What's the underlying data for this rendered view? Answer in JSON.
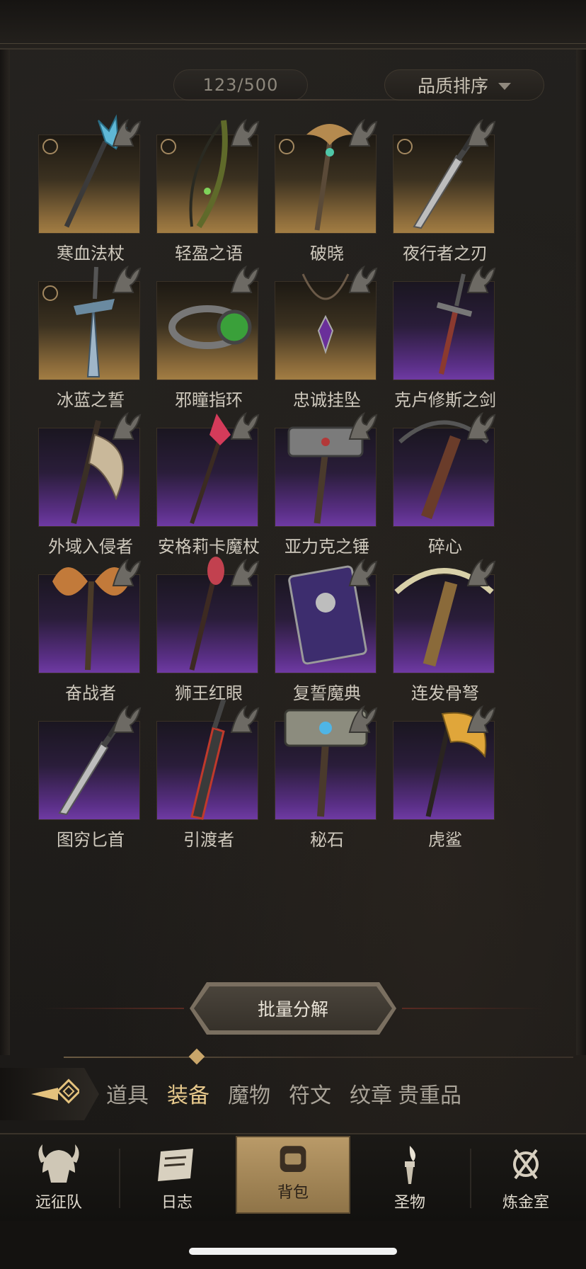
{
  "header": {
    "capacity": "123/500",
    "sort_label": "品质排序"
  },
  "items": [
    {
      "name": "寒血法杖",
      "rarity": "gold",
      "marked": true,
      "icon": "ice-staff"
    },
    {
      "name": "轻盈之语",
      "rarity": "gold",
      "marked": true,
      "icon": "bow"
    },
    {
      "name": "破晓",
      "rarity": "gold",
      "marked": true,
      "icon": "scepter"
    },
    {
      "name": "夜行者之刃",
      "rarity": "gold",
      "marked": true,
      "icon": "dagger"
    },
    {
      "name": "冰蓝之誓",
      "rarity": "gold",
      "marked": true,
      "icon": "ice-sword"
    },
    {
      "name": "邪瞳指环",
      "rarity": "gold",
      "marked": false,
      "icon": "ring"
    },
    {
      "name": "忠诚挂坠",
      "rarity": "gold",
      "marked": false,
      "icon": "pendant"
    },
    {
      "name": "克卢修斯之剑",
      "rarity": "purple",
      "marked": false,
      "icon": "sword"
    },
    {
      "name": "外域入侵者",
      "rarity": "purple",
      "marked": false,
      "icon": "axe"
    },
    {
      "name": "安格莉卡魔杖",
      "rarity": "purple",
      "marked": false,
      "icon": "wand"
    },
    {
      "name": "亚力克之锤",
      "rarity": "purple",
      "marked": false,
      "icon": "hammer"
    },
    {
      "name": "碎心",
      "rarity": "purple",
      "marked": false,
      "icon": "crossbow"
    },
    {
      "name": "奋战者",
      "rarity": "purple",
      "marked": false,
      "icon": "battle-axe"
    },
    {
      "name": "狮王红眼",
      "rarity": "purple",
      "marked": false,
      "icon": "ruby-wand"
    },
    {
      "name": "复誓魔典",
      "rarity": "purple",
      "marked": false,
      "icon": "tome"
    },
    {
      "name": "连发骨弩",
      "rarity": "purple",
      "marked": false,
      "icon": "bone-crossbow"
    },
    {
      "name": "图穷匕首",
      "rarity": "purple",
      "marked": false,
      "icon": "dagger"
    },
    {
      "name": "引渡者",
      "rarity": "purple",
      "marked": false,
      "icon": "greatsword"
    },
    {
      "name": "秘石",
      "rarity": "purple",
      "marked": false,
      "icon": "maul"
    },
    {
      "name": "虎鲨",
      "rarity": "purple",
      "marked": false,
      "icon": "golden-axe"
    }
  ],
  "batch_button": "批量分解",
  "categories": [
    {
      "label": "道具",
      "active": false
    },
    {
      "label": "装备",
      "active": true
    },
    {
      "label": "魔物",
      "active": false
    },
    {
      "label": "符文",
      "active": false
    },
    {
      "label": "纹章",
      "active": false
    },
    {
      "label": "贵重品",
      "active": false
    }
  ],
  "nav": [
    {
      "label": "远征队",
      "icon": "helmet-icon",
      "active": false
    },
    {
      "label": "日志",
      "icon": "scroll-icon",
      "active": false
    },
    {
      "label": "背包",
      "icon": "backpack-icon",
      "active": true
    },
    {
      "label": "圣物",
      "icon": "torch-icon",
      "active": false
    },
    {
      "label": "炼金室",
      "icon": "alchemy-icon",
      "active": false
    }
  ],
  "colors": {
    "gold_tile": "#a27d43",
    "purple_tile": "#6e3aa3",
    "active_tab": "#e7c98c",
    "active_nav": "#b99a68"
  }
}
